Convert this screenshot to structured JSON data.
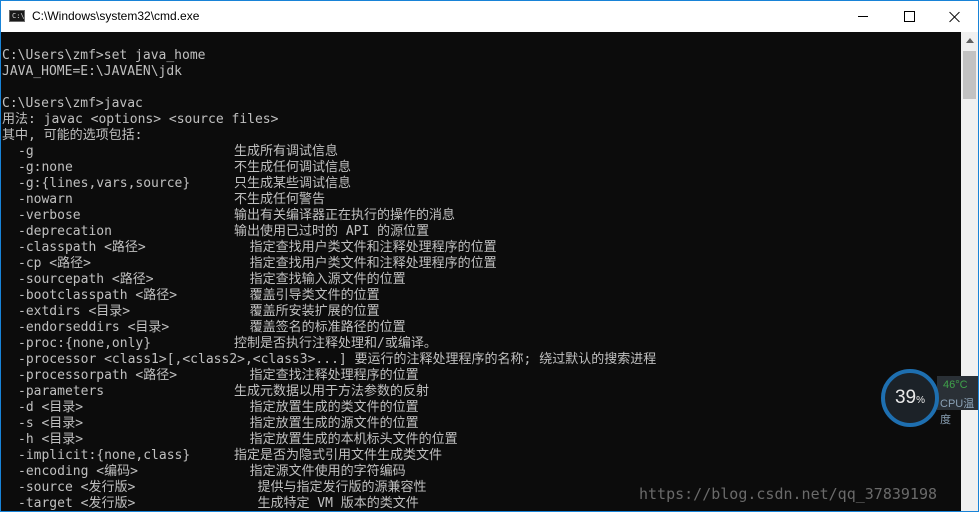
{
  "window": {
    "title": "C:\\Windows\\system32\\cmd.exe",
    "icon_text": "C:\\",
    "controls": {
      "minimize": "minimize-icon",
      "maximize": "maximize-icon",
      "close": "close-icon"
    }
  },
  "console": {
    "intro_lines": [
      "C:\\Users\\zmf>set java_home",
      "JAVA_HOME=E:\\JAVAEN\\jdk",
      "",
      "C:\\Users\\zmf>javac",
      "用法: javac <options> <source files>",
      "其中, 可能的选项包括:"
    ],
    "options": [
      {
        "flag": "-g",
        "desc": "生成所有调试信息"
      },
      {
        "flag": "-g:none",
        "desc": "不生成任何调试信息"
      },
      {
        "flag": "-g:{lines,vars,source}",
        "desc": "只生成某些调试信息"
      },
      {
        "flag": "-nowarn",
        "desc": "不生成任何警告"
      },
      {
        "flag": "-verbose",
        "desc": "输出有关编译器正在执行的操作的消息"
      },
      {
        "flag": "-deprecation",
        "desc": "输出使用已过时的 API 的源位置"
      },
      {
        "flag": "-classpath <路径>",
        "desc": "  指定查找用户类文件和注释处理程序的位置"
      },
      {
        "flag": "-cp <路径>",
        "desc": "  指定查找用户类文件和注释处理程序的位置"
      },
      {
        "flag": "-sourcepath <路径>",
        "desc": "  指定查找输入源文件的位置"
      },
      {
        "flag": "-bootclasspath <路径>",
        "desc": "  覆盖引导类文件的位置"
      },
      {
        "flag": "-extdirs <目录>",
        "desc": "  覆盖所安装扩展的位置"
      },
      {
        "flag": "-endorseddirs <目录>",
        "desc": "  覆盖签名的标准路径的位置"
      },
      {
        "flag": "-proc:{none,only}",
        "desc": "控制是否执行注释处理和/或编译。"
      },
      {
        "flag": "-processor <class1>[,<class2>,<class3>...] 要运行的注释处理程序的名称; 绕过默认的搜索进程",
        "desc": ""
      },
      {
        "flag": "-processorpath <路径>",
        "desc": "  指定查找注释处理程序的位置"
      },
      {
        "flag": "-parameters",
        "desc": "生成元数据以用于方法参数的反射"
      },
      {
        "flag": "-d <目录>",
        "desc": "  指定放置生成的类文件的位置"
      },
      {
        "flag": "-s <目录>",
        "desc": "  指定放置生成的源文件的位置"
      },
      {
        "flag": "-h <目录>",
        "desc": "  指定放置生成的本机标头文件的位置"
      },
      {
        "flag": "-implicit:{none,class}",
        "desc": "指定是否为隐式引用文件生成类文件"
      },
      {
        "flag": "-encoding <编码>",
        "desc": "  指定源文件使用的字符编码"
      },
      {
        "flag": "-source <发行版>",
        "desc": "   提供与指定发行版的源兼容性"
      },
      {
        "flag": "-target <发行版>",
        "desc": "   生成特定 VM 版本的类文件"
      }
    ]
  },
  "cpu_widget": {
    "percent": "39",
    "percent_sign": "%",
    "temp": "46°C",
    "label": "CPU温度"
  },
  "watermark": "https://blog.csdn.net/qq_37839198",
  "colors": {
    "console_bg": "#0c0c0c",
    "console_text": "#c0c0c0",
    "titlebar_bg": "#ffffff",
    "border": "#1883d7"
  }
}
